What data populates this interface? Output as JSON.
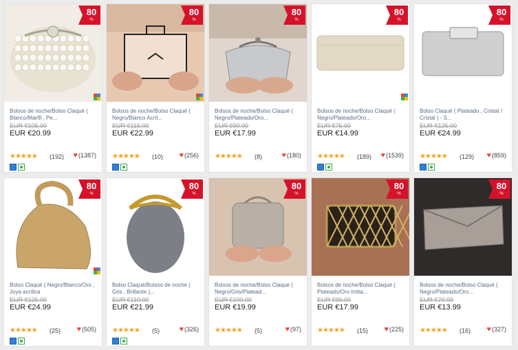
{
  "badge": {
    "value": "80",
    "sub": "%"
  },
  "products": [
    {
      "name": "Bolsos de noche/Bolso Claqué ( Blanco/Marfil , Pe...",
      "old_price": "EUR €105.00",
      "price": "EUR €20.99",
      "reviews": "(192)",
      "likes": "(1387)",
      "has_quad": true,
      "has_icons": true,
      "image": "pearl-clutch"
    },
    {
      "name": "Bolsos de noche/Bolso Claqué ( Negro/Blanco Acríl...",
      "old_price": "EUR €115.00",
      "price": "EUR €22.99",
      "reviews": "(10)",
      "likes": "(256)",
      "has_quad": true,
      "has_icons": true,
      "image": "acrylic-box"
    },
    {
      "name": "Bolsos de noche/Bolso Claqué ( Negro/Plateado/Oro...",
      "old_price": "EUR €90.00",
      "price": "EUR €17.99",
      "reviews": "(8)",
      "likes": "(180)",
      "has_quad": false,
      "has_icons": false,
      "image": "silver-clutch"
    },
    {
      "name": "Bolsos de noche/Bolso Claqué ( Negro/Plateado/Oro...",
      "old_price": "EUR €75.00",
      "price": "EUR €14.99",
      "reviews": "(189)",
      "likes": "(1539)",
      "has_quad": true,
      "has_icons": true,
      "image": "gold-envelope"
    },
    {
      "name": "Bolso Claqué ( Plateado , Cristal / Cristal ) - S...",
      "old_price": "EUR €125.00",
      "price": "EUR €24.99",
      "reviews": "(129)",
      "likes": "(859)",
      "has_quad": false,
      "has_icons": true,
      "image": "crystal-clutch"
    },
    {
      "name": "Bolso Claqué ( Negro/Blanco/Oro , Joya acrílica",
      "old_price": "EUR €125.00",
      "price": "EUR €24.99",
      "reviews": "(25)",
      "likes": "(505)",
      "has_quad": true,
      "has_icons": true,
      "image": "gold-pouch"
    },
    {
      "name": "Bolso Claqué/Bolsos de noche ( Gris , Brillante )...",
      "old_price": "EUR €110.00",
      "price": "EUR €21.99",
      "reviews": "(5)",
      "likes": "(326)",
      "has_quad": false,
      "has_icons": true,
      "image": "egg-bag"
    },
    {
      "name": "Bolsos de noche/Bolso Claqué ( Negro/Gris/Platead...",
      "old_price": "EUR €100.00",
      "price": "EUR €19.99",
      "reviews": "(5)",
      "likes": "(97)",
      "has_quad": false,
      "has_icons": false,
      "image": "sequin-clutch"
    },
    {
      "name": "Bolsos de noche/Bolso Claqué ( Plateado/Oro Imita...",
      "old_price": "EUR €90.00",
      "price": "EUR €17.99",
      "reviews": "(15)",
      "likes": "(225)",
      "has_quad": false,
      "has_icons": false,
      "image": "lattice-clutch"
    },
    {
      "name": "Bolsos de noche/Bolso Claqué ( Negro/Plateado/Oro...",
      "old_price": "EUR €70.00",
      "price": "EUR €13.99",
      "reviews": "(16)",
      "likes": "(327)",
      "has_quad": false,
      "has_icons": false,
      "image": "metal-envelope"
    }
  ],
  "stars_text": "★★★★★",
  "colors": {
    "badge": "#d6122a",
    "star": "#f4a21b",
    "heart": "#e94b3c",
    "name_link": "#5a6a85"
  }
}
